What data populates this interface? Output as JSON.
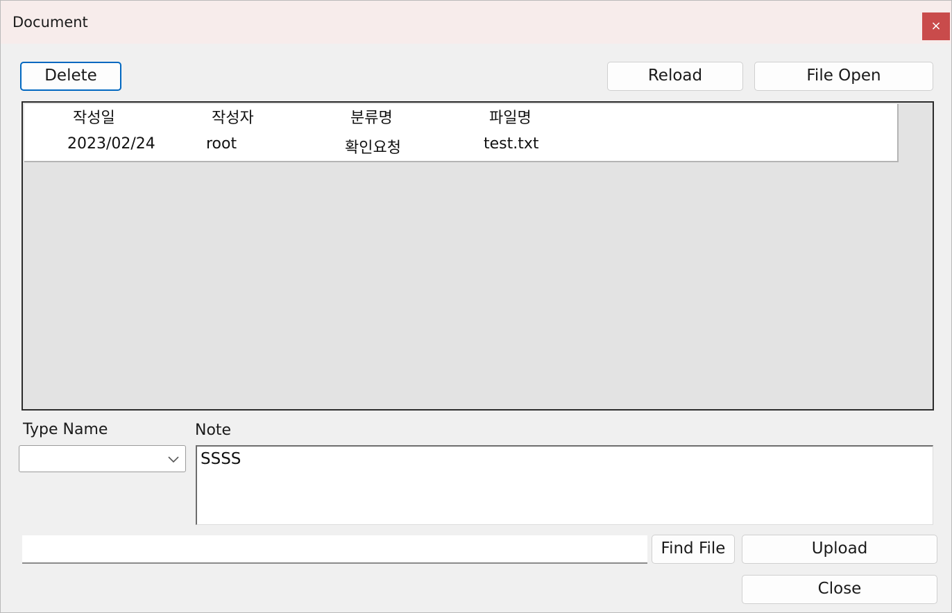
{
  "window": {
    "title": "Document",
    "close_glyph": "×"
  },
  "toolbar": {
    "delete_label": "Delete",
    "reload_label": "Reload",
    "file_open_label": "File Open"
  },
  "grid": {
    "columns": [
      "작성일",
      "작성자",
      "분류명",
      "파일명"
    ],
    "rows": [
      [
        "2023/02/24",
        "root",
        "확인요청",
        "test.txt"
      ]
    ]
  },
  "form": {
    "type_name_label": "Type Name",
    "type_name_value": "",
    "note_label": "Note",
    "note_value": "SSSS",
    "file_path_value": ""
  },
  "actions": {
    "find_file_label": "Find File",
    "upload_label": "Upload",
    "close_label": "Close"
  },
  "icons": {
    "close": "close-icon",
    "dropdown": "chevron-down-icon"
  },
  "colors": {
    "titlebar": "#f7eceb",
    "close_button": "#c94b4b",
    "focus_accent": "#0067c0",
    "grid_background": "#e3e3e3"
  }
}
